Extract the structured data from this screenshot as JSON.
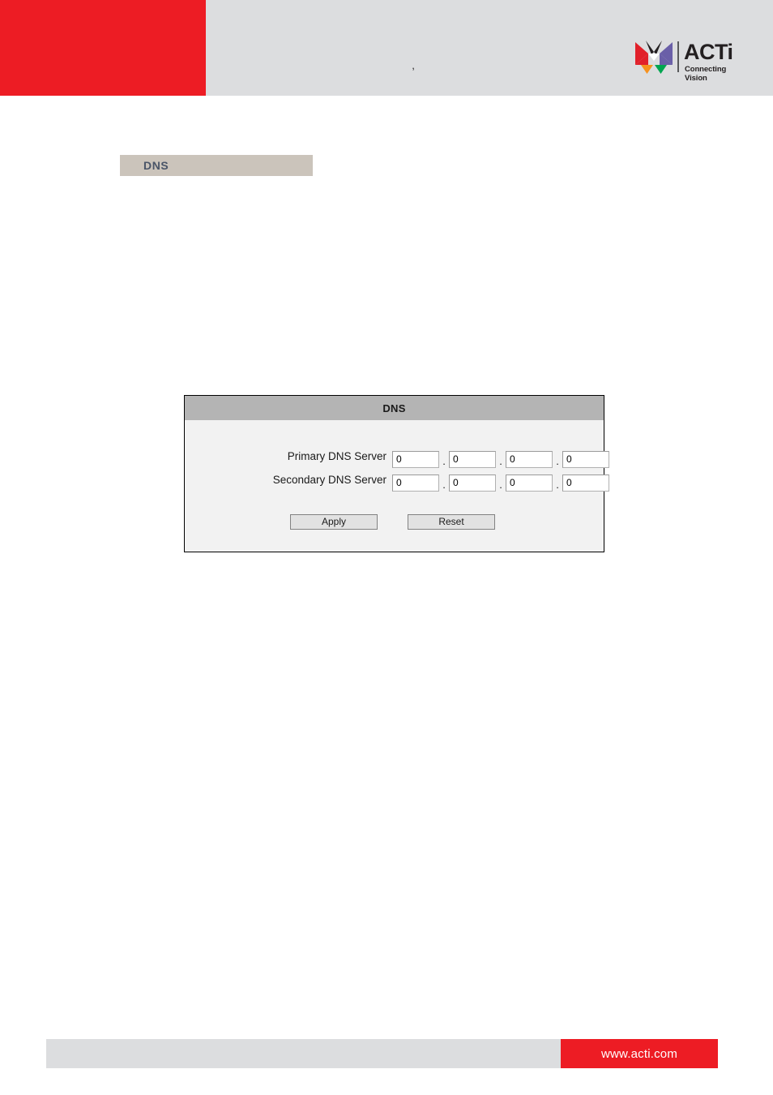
{
  "header": {
    "title": ",",
    "brand": {
      "wordmark": "ACTi",
      "tagline": "Connecting Vision",
      "mark_colors": {
        "top_left": "#e1202a",
        "top_right": "#6a5fa8",
        "bottom_left": "#f6921e",
        "bottom_right": "#00a550"
      },
      "accent_red": "#ed1c24"
    }
  },
  "section": {
    "label": "DNS",
    "band_color": "#cbc4bb",
    "label_color": "#4a5568"
  },
  "panel": {
    "title": "DNS",
    "titlebar_color": "#b4b4b4",
    "body_color": "#f2f2f2",
    "fields": [
      {
        "label": "Primary DNS Server",
        "octets": [
          "0",
          "0",
          "0",
          "0"
        ],
        "separator": "."
      },
      {
        "label": "Secondary DNS Server",
        "octets": [
          "0",
          "0",
          "0",
          "0"
        ],
        "separator": "."
      }
    ],
    "buttons": {
      "apply": "Apply",
      "reset": "Reset"
    }
  },
  "footer": {
    "url": "www.acti.com",
    "bar_color": "#dcdddf",
    "url_block_color": "#ed1c24"
  }
}
